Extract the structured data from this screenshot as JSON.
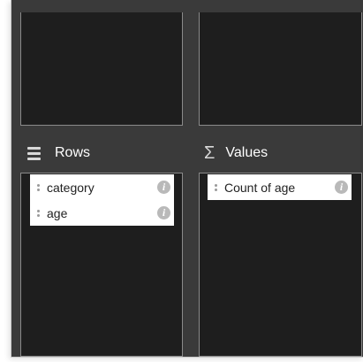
{
  "rows_section": {
    "title": "Rows",
    "icon": "hamburger-icon",
    "fields": [
      {
        "label": "category"
      },
      {
        "label": "age"
      }
    ]
  },
  "values_section": {
    "title": "Values",
    "icon": "sigma-icon",
    "fields": [
      {
        "label": "Count of age"
      }
    ]
  },
  "info_glyph": "i",
  "sigma_glyph": "Σ"
}
